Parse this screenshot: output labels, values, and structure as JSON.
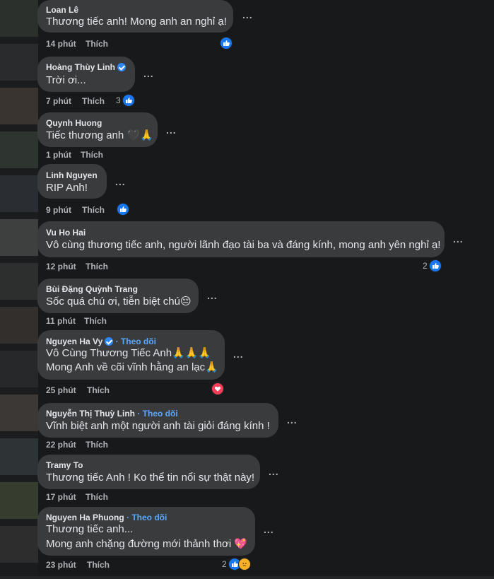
{
  "comments": [
    {
      "name": "Loan Lê",
      "lines": [
        "Thương tiếc anh! Mong anh an nghỉ ạ!"
      ],
      "time": "14 phút",
      "like": "Thích",
      "reaction": {
        "type": "like",
        "count": ""
      }
    },
    {
      "name": "Hoàng Thùy Linh",
      "verified": true,
      "lines": [
        "Trời ơi..."
      ],
      "time": "7 phút",
      "like": "Thích",
      "reaction": {
        "type": "like",
        "count": "3"
      }
    },
    {
      "name": "Quynh Huong",
      "lines": [
        "Tiếc thương anh 🖤🙏"
      ],
      "time": "1 phút",
      "like": "Thích"
    },
    {
      "name": "Linh Nguyen",
      "lines": [
        "RIP Anh!"
      ],
      "time": "9 phút",
      "like": "Thích",
      "reaction": {
        "type": "like",
        "count": ""
      }
    },
    {
      "name": "Vu Ho Hai",
      "lines": [
        "Vô cùng thương tiếc anh, người lãnh đạo tài ba và đáng kính, mong anh yên nghỉ ạ!"
      ],
      "time": "12 phút",
      "like": "Thích",
      "reaction": {
        "type": "like",
        "count": "2"
      }
    },
    {
      "name": "Bùi Đặng Quỳnh Trang",
      "lines": [
        "Sốc quá chú ơi, tiễn biệt chú😔"
      ],
      "time": "11 phút",
      "like": "Thích"
    },
    {
      "name": "Nguyen Ha Vy",
      "verified": true,
      "follow": "Theo dõi",
      "lines": [
        "Vô Cùng Thương Tiếc Anh🙏🙏🙏",
        "Mong Anh về cõi vĩnh hằng an lạc🙏"
      ],
      "time": "25 phút",
      "like": "Thích",
      "reaction": {
        "type": "heart",
        "count": ""
      }
    },
    {
      "name": "Nguyễn Thị Thuỳ Linh",
      "follow": "Theo dõi",
      "lines": [
        "Vĩnh biệt anh một người anh tài giỏi đáng kính !"
      ],
      "time": "22 phút",
      "like": "Thích"
    },
    {
      "name": "Tramy To",
      "lines": [
        "Thương tiếc Anh ! Ko thể tin nổi sự thật này!"
      ],
      "time": "17 phút",
      "like": "Thích"
    },
    {
      "name": "Nguyen Ha Phuong",
      "follow": "Theo dõi",
      "lines": [
        "Thương tiếc anh...",
        "Mong anh chặng đường mới thảnh thơi 💖"
      ],
      "time": "23 phút",
      "like": "Thích",
      "reaction": {
        "type": "like-sad",
        "count": "2"
      }
    }
  ],
  "more_label": "...",
  "follow_separator": " · "
}
